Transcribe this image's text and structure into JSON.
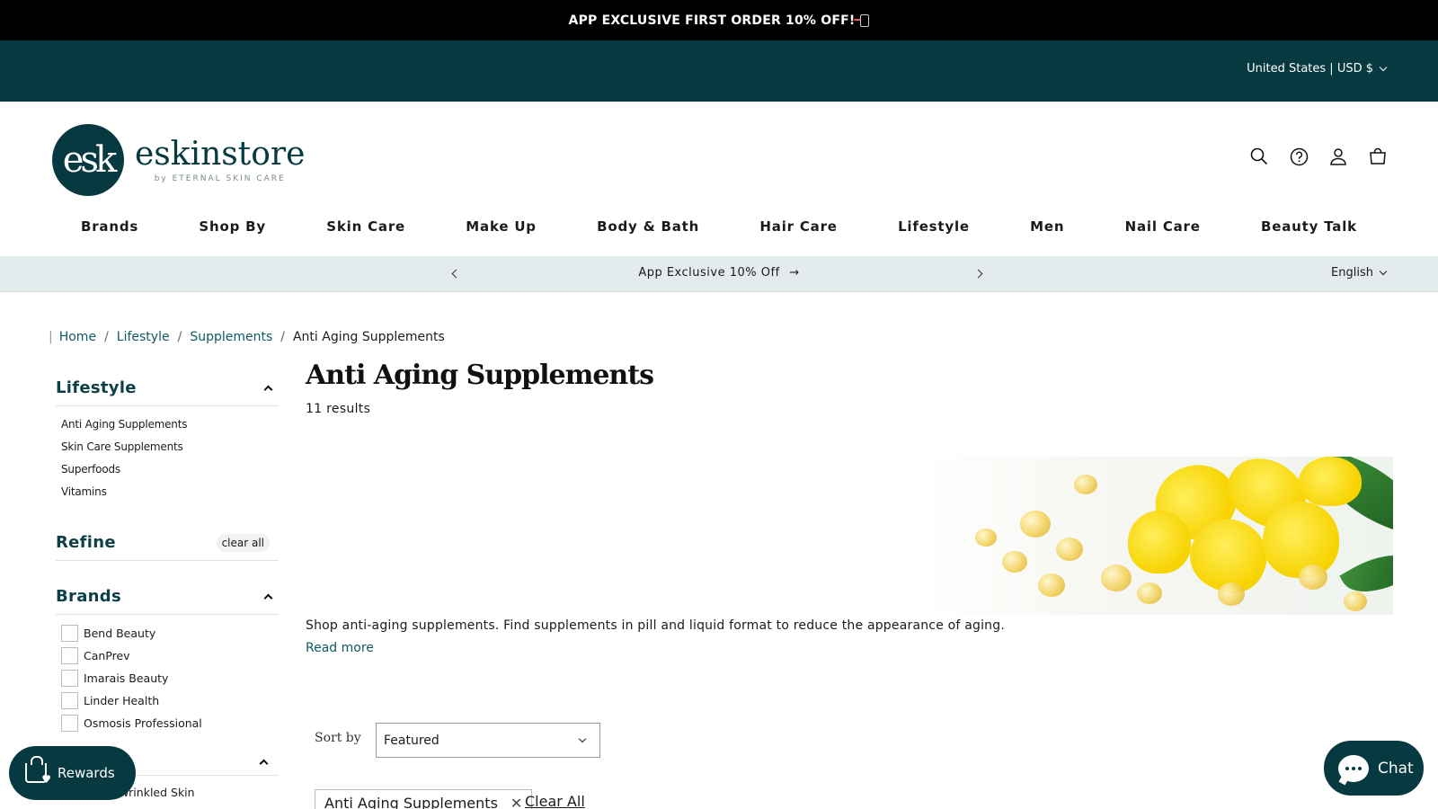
{
  "announcement": {
    "text": "APP EXCLUSIVE FIRST ORDER 10% OFF!"
  },
  "locale": {
    "country": "United States | USD $",
    "language": "English"
  },
  "logo": {
    "mark": "esk",
    "name": "eskinstore",
    "tagline": "by ETERNAL SKIN CARE"
  },
  "header_icons": [
    "search-icon",
    "help-icon",
    "account-icon",
    "cart-icon"
  ],
  "nav": [
    "Brands",
    "Shop By",
    "Skin Care",
    "Make Up",
    "Body & Bath",
    "Hair Care",
    "Lifestyle",
    "Men",
    "Nail Care",
    "Beauty Talk"
  ],
  "promo": {
    "text": "App Exclusive 10% Off"
  },
  "breadcrumb": {
    "items": [
      "Home",
      "Lifestyle",
      "Supplements"
    ],
    "current": "Anti Aging Supplements"
  },
  "sidebar": {
    "category_title": "Lifestyle",
    "category_items": [
      "Anti Aging Supplements",
      "Skin Care Supplements",
      "Superfoods",
      "Vitamins"
    ],
    "refine_title": "Refine",
    "clear_all": "clear all",
    "brands_title": "Brands",
    "brands": [
      "Bend Beauty",
      "CanPrev",
      "Imarais Beauty",
      "Linder Health",
      "Osmosis Professional"
    ],
    "concern_partial": "les & Wrinkled Skin",
    "concern_title_partial": "s"
  },
  "main": {
    "title": "Anti Aging Supplements",
    "results": "11 results",
    "description": "Shop anti-aging supplements. Find supplements in pill and liquid format to reduce the appearance of aging.",
    "read_more": "Read more",
    "sort_label": "Sort by",
    "sort_value": "Featured",
    "active_filter": "Anti Aging Supplements",
    "clear_all": "Clear All"
  },
  "widgets": {
    "rewards": "Rewards",
    "chat": "Chat"
  },
  "colors": {
    "brand": "#063a40",
    "promo_bg": "#e4ebec",
    "link": "#0d5a60"
  }
}
